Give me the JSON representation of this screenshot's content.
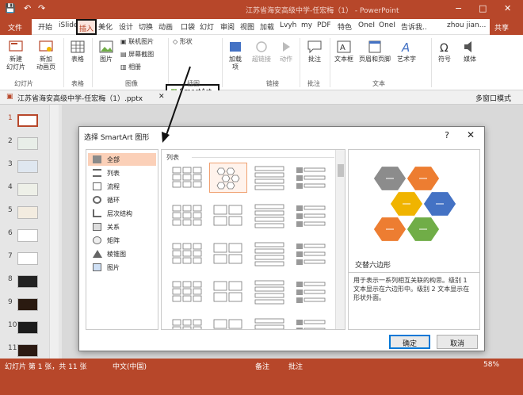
{
  "titlebar": {
    "title": "江苏省海安高级中学-任宏梅（1） - PowerPoint",
    "save_glyph": "💾",
    "undo_glyph": "↶",
    "redo_glyph": "↷",
    "min_glyph": "−",
    "max_glyph": "□",
    "close_glyph": "✕"
  },
  "tabs": [
    "开始",
    "iSlide",
    "插入",
    "美化",
    "设计",
    "切换",
    "动画",
    "口袋",
    "幻灯",
    "审阅",
    "视图",
    "加载",
    "Lvyh",
    "my",
    "PDF",
    "特色",
    "OneI",
    "OneI",
    "告诉我..",
    "zhou jian..."
  ],
  "file_tab": "文件",
  "share_label": "共享",
  "ribbon": {
    "new_slide": "新建\n幻灯片",
    "new_anim": "新加\n动画页",
    "table": "表格",
    "picture": "图片",
    "online_pic": "联机图片",
    "screenshot": "屏幕截图",
    "album": "相册",
    "shapes": "形状",
    "smartart": "SmartArt",
    "addins": "加载\n项",
    "hyperlink": "超链接",
    "action": "动作",
    "comment": "批注",
    "textbox": "文本框",
    "header_footer": "页眉和页脚",
    "wordart": "艺术字",
    "symbol": "符号",
    "media": "媒体",
    "groups": [
      "幻灯片",
      "表格",
      "图像",
      "插图",
      "链接",
      "批注",
      "文本"
    ]
  },
  "doctab": {
    "name": "江苏省海安高级中学-任宏梅（1）.pptx",
    "close": "✕",
    "multiwin": "多窗口模式"
  },
  "slides": [
    "1",
    "2",
    "3",
    "4",
    "5",
    "6",
    "7",
    "8",
    "9",
    "10",
    "11"
  ],
  "dialog": {
    "title": "选择 SmartArt 图形",
    "help": "?",
    "close": "✕",
    "categories": [
      "全部",
      "列表",
      "流程",
      "循环",
      "层次结构",
      "关系",
      "矩阵",
      "棱锥图",
      "图片"
    ],
    "gallery_header": "列表",
    "preview_name": "交替六边形",
    "preview_desc": "用于表示一系列相互关联的构思。级别 1 文本显示在六边形中。级别 2 文本显示在形状外面。",
    "ok": "确定",
    "cancel": "取消"
  },
  "statusbar": {
    "slide_info": "幻灯片 第 1 张，共 11 张",
    "lang": "中文(中国)",
    "notes": "备注",
    "comments": "批注",
    "zoom": "58%"
  },
  "colors": {
    "accent": "#b7472a",
    "hex_gray": "#8c8c8c",
    "hex_orange": "#ed7d31",
    "hex_yellow": "#f0b400",
    "hex_blue": "#4472c4",
    "hex_green": "#70ad47"
  }
}
